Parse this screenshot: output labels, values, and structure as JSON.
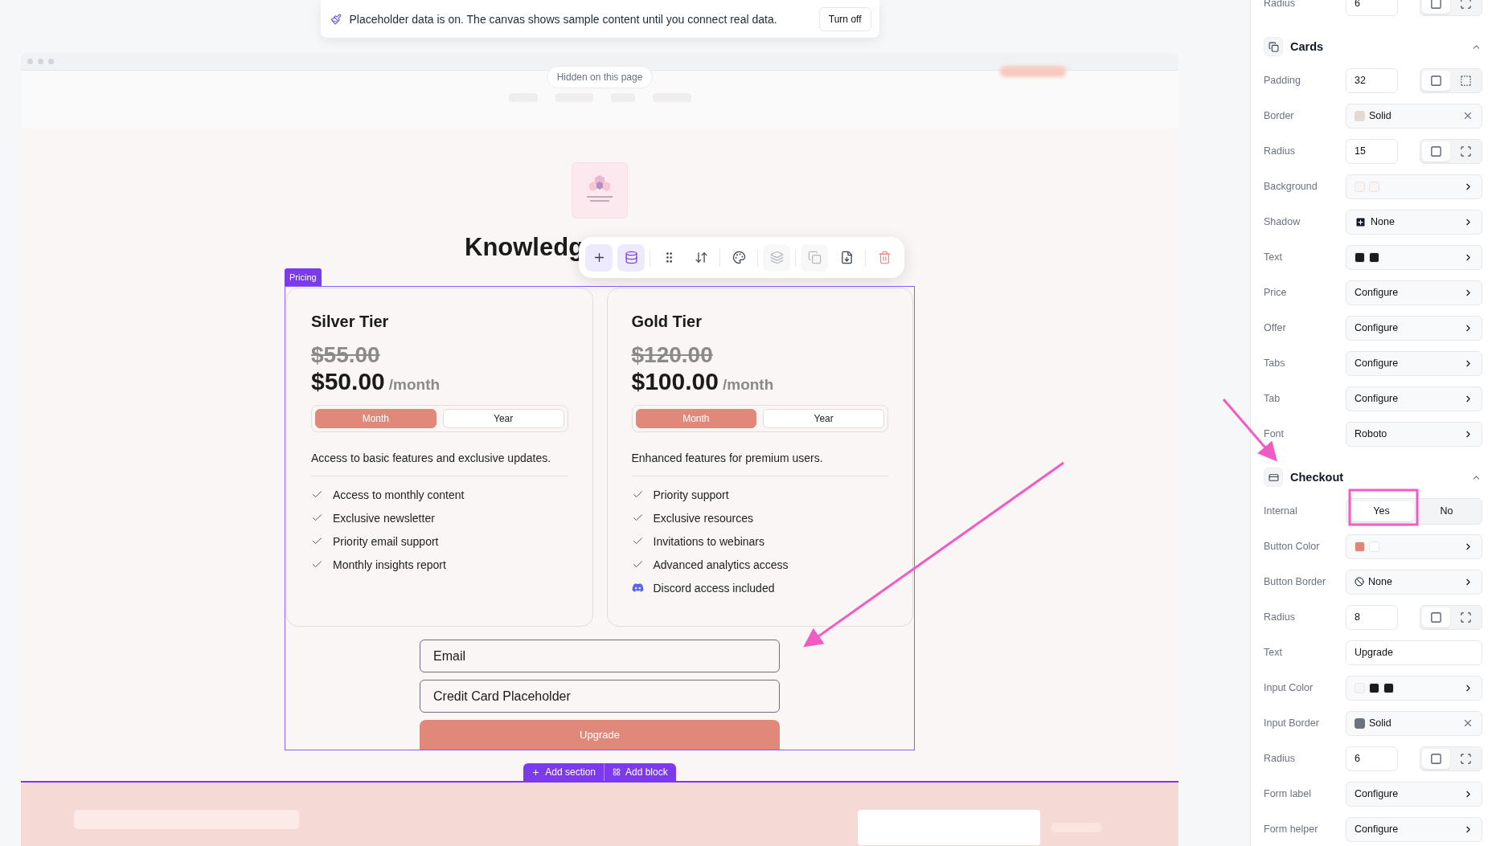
{
  "banner": {
    "message": "Placeholder data is on. The canvas shows sample content until you connect real data.",
    "button": "Turn off"
  },
  "site_header": {
    "badge": "Hidden on this page"
  },
  "page_title": "Knowledg",
  "toolbar": {
    "tools": [
      {
        "kind": "add",
        "selected": true,
        "disabled": false
      },
      {
        "kind": "data",
        "selected": true,
        "disabled": false
      },
      {
        "kind": "drag",
        "selected": false,
        "disabled": false
      },
      {
        "kind": "reorder",
        "selected": false,
        "disabled": false
      },
      {
        "kind": "style",
        "selected": false,
        "disabled": false
      },
      {
        "kind": "layers",
        "selected": false,
        "disabled": true
      },
      {
        "kind": "duplicate",
        "selected": false,
        "disabled": true
      },
      {
        "kind": "export",
        "selected": false,
        "disabled": false
      },
      {
        "kind": "delete",
        "selected": false,
        "disabled": false
      }
    ]
  },
  "section": {
    "tag": "Pricing",
    "cards": [
      {
        "title": "Silver Tier",
        "old_price": "$55.00",
        "price": "$50.00",
        "period": "/month",
        "tabs": [
          {
            "label": "Month",
            "selected": true
          },
          {
            "label": "Year",
            "selected": false
          }
        ],
        "description": "Access to basic features and exclusive updates.",
        "features": [
          {
            "kind": "check",
            "text": "Access to monthly content"
          },
          {
            "kind": "check",
            "text": "Exclusive newsletter"
          },
          {
            "kind": "check",
            "text": "Priority email support"
          },
          {
            "kind": "check",
            "text": "Monthly insights report"
          }
        ]
      },
      {
        "title": "Gold Tier",
        "old_price": "$120.00",
        "price": "$100.00",
        "period": "/month",
        "tabs": [
          {
            "label": "Month",
            "selected": true
          },
          {
            "label": "Year",
            "selected": false
          }
        ],
        "description": "Enhanced features for premium users.",
        "features": [
          {
            "kind": "check",
            "text": "Priority support"
          },
          {
            "kind": "check",
            "text": "Exclusive resources"
          },
          {
            "kind": "check",
            "text": "Invitations to webinars"
          },
          {
            "kind": "check",
            "text": "Advanced analytics access"
          },
          {
            "kind": "discord",
            "text": "Discord access included"
          }
        ]
      }
    ],
    "form": {
      "email_placeholder": "Email",
      "card_placeholder": "Credit Card Placeholder",
      "button": "Upgrade"
    }
  },
  "add_buttons": [
    "Add section",
    "Add block"
  ],
  "panel": {
    "top_rows": [
      {
        "kind": "number",
        "label": "Radius",
        "value": "6",
        "modes": [
          {
            "kind": "uniform",
            "selected": true
          },
          {
            "kind": "corners",
            "selected": false
          }
        ]
      }
    ],
    "sections": [
      {
        "title": "Cards",
        "expanded": true,
        "rows": [
          {
            "kind": "number",
            "label": "Padding",
            "value": "32",
            "modes": [
              {
                "kind": "uniform",
                "selected": true
              },
              {
                "kind": "sides",
                "selected": false
              }
            ]
          },
          {
            "kind": "border",
            "label": "Border",
            "value": "Solid",
            "color": "#e5d9d5"
          },
          {
            "kind": "number",
            "label": "Radius",
            "value": "15",
            "modes": [
              {
                "kind": "uniform",
                "selected": true
              },
              {
                "kind": "corners",
                "selected": false
              }
            ]
          },
          {
            "kind": "select",
            "label": "Background",
            "swatches": [
              {
                "color": "#f9f3f1"
              },
              {
                "color": "#f9f3f1"
              }
            ]
          },
          {
            "kind": "shadow",
            "label": "Shadow",
            "value": "None"
          },
          {
            "kind": "select",
            "label": "Text",
            "swatches": [
              {
                "color": "#1c1c1c"
              },
              {
                "color": "#1c1c1c"
              }
            ]
          },
          {
            "kind": "select",
            "label": "Price",
            "value": "Configure"
          },
          {
            "kind": "select",
            "label": "Offer",
            "value": "Configure"
          },
          {
            "kind": "select",
            "label": "Tabs",
            "value": "Configure"
          },
          {
            "kind": "select",
            "label": "Tab",
            "value": "Configure"
          },
          {
            "kind": "select",
            "label": "Font",
            "value": "Roboto"
          }
        ]
      },
      {
        "title": "Checkout",
        "expanded": true,
        "rows": [
          {
            "kind": "toggle",
            "label": "Internal",
            "options": [
              {
                "label": "Yes",
                "selected": true
              },
              {
                "label": "No",
                "selected": false
              }
            ]
          },
          {
            "kind": "select",
            "label": "Button Color",
            "swatches": [
              {
                "color": "#e08574"
              },
              {
                "color": "#ffffff"
              }
            ]
          },
          {
            "kind": "stroke",
            "label": "Button Border",
            "value": "None"
          },
          {
            "kind": "number",
            "label": "Radius",
            "value": "8",
            "modes": [
              {
                "kind": "uniform",
                "selected": true
              },
              {
                "kind": "corners",
                "selected": false
              }
            ]
          },
          {
            "kind": "text",
            "label": "Text",
            "value": "Upgrade"
          },
          {
            "kind": "select",
            "label": "Input Color",
            "swatches": [
              {
                "color": "#f9f3f1"
              },
              {
                "color": "#1c1c1c"
              },
              {
                "color": "#1c1c1c"
              }
            ]
          },
          {
            "kind": "border",
            "label": "Input Border",
            "value": "Solid",
            "color": "#6b7280"
          },
          {
            "kind": "number",
            "label": "Radius",
            "value": "6",
            "modes": [
              {
                "kind": "uniform",
                "selected": true
              },
              {
                "kind": "corners",
                "selected": false
              }
            ]
          },
          {
            "kind": "select",
            "label": "Form label",
            "value": "Configure"
          },
          {
            "kind": "select",
            "label": "Form helper",
            "value": "Configure"
          }
        ]
      }
    ]
  }
}
